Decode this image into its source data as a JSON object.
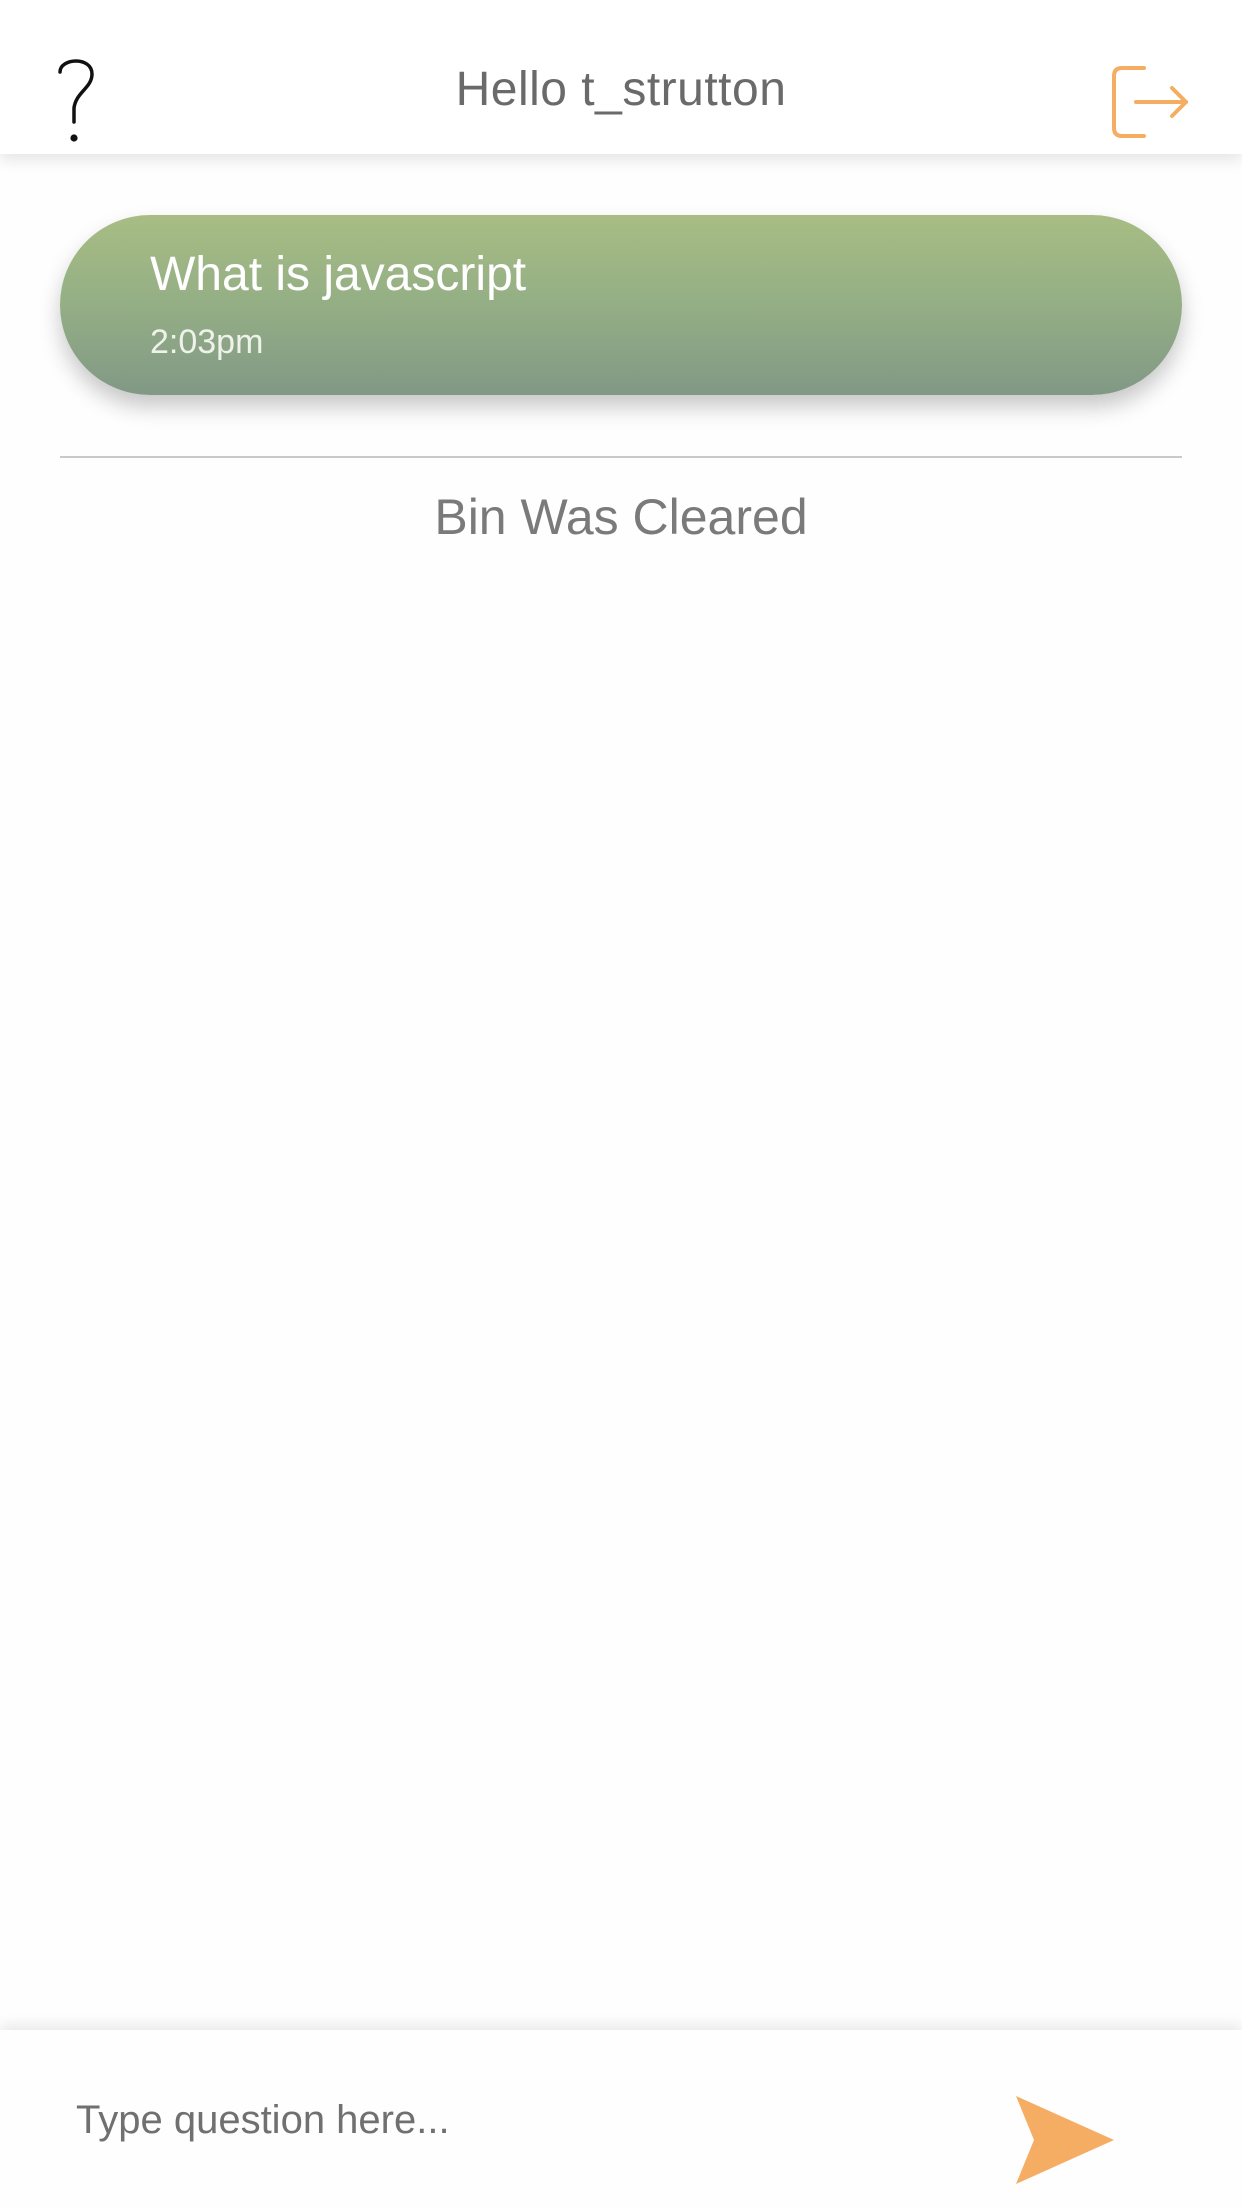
{
  "header": {
    "title": "Hello t_strutton",
    "help_icon": "question-mark-icon",
    "logout_icon": "logout-icon"
  },
  "questions": [
    {
      "text": "What is javascript",
      "time": "2:03pm"
    }
  ],
  "bin": {
    "status": "Bin Was Cleared"
  },
  "input": {
    "placeholder": "Type question here...",
    "value": "",
    "send_icon": "send-icon"
  },
  "colors": {
    "accent": "#f5ad63",
    "bubble_top": "#a8bd84",
    "bubble_bottom": "#819985",
    "title_text": "#6a6a6a"
  }
}
